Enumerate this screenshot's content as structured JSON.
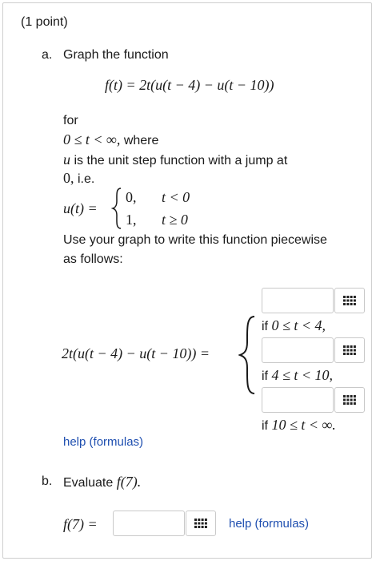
{
  "header": {
    "points": "(1 point)"
  },
  "part_a": {
    "label": "a.",
    "instruction": "Graph the function",
    "function_def": "f(t) = 2t(u(t − 4) − u(t − 10))",
    "for_label": "for",
    "domain": "0 ≤ t < ∞,",
    "where": "where",
    "u_var": "u",
    "unit_step_desc": "is the unit step function with a jump at",
    "jump_point": "0,",
    "ie": "i.e.",
    "u_lhs": "u(t) =",
    "u_case1_value": "0,",
    "u_case1_cond": "t < 0",
    "u_case2_value": "1,",
    "u_case2_cond": "t ≥ 0",
    "piecewise_instruction_line1": "Use your graph to write this function piecewise",
    "piecewise_instruction_line2": "as follows:",
    "piecewise_lhs": "2t(u(t − 4) − u(t − 10)) =",
    "pieces": [
      {
        "if_word": "if",
        "condition": "0 ≤ t < 4,",
        "value": ""
      },
      {
        "if_word": "if",
        "condition": "4 ≤ t < 10,",
        "value": ""
      },
      {
        "if_word": "if",
        "condition": "10 ≤ t < ∞.",
        "value": ""
      }
    ],
    "help_link": "help (formulas)"
  },
  "part_b": {
    "label": "b.",
    "instruction": "Evaluate",
    "expr": "f(7).",
    "lhs": "f(7) =",
    "answer_value": "",
    "help_link": "help (formulas)"
  },
  "icons": {
    "keypad": "keypad-grid-icon"
  }
}
